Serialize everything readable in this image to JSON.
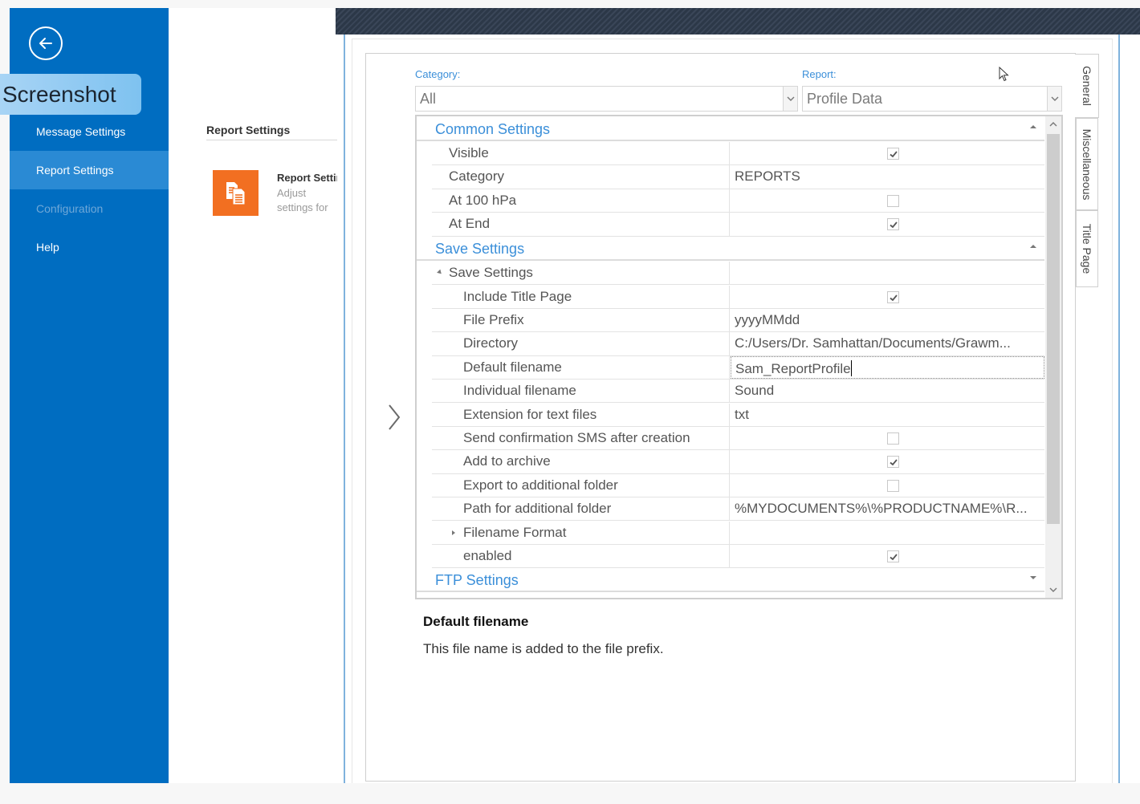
{
  "overlay_badge": "Screenshot",
  "sidebar": {
    "back_label": "Back",
    "items": [
      {
        "label": "Message Settings",
        "state": "normal"
      },
      {
        "label": "Report Settings",
        "state": "active"
      },
      {
        "label": "Configuration",
        "state": "disabled"
      },
      {
        "label": "Help",
        "state": "normal"
      }
    ]
  },
  "middle": {
    "section_title": "Report Settings",
    "tile": {
      "title": "Report Settings",
      "description": "Adjust settings for the design of the"
    }
  },
  "filters": {
    "category_label": "Category:",
    "category_value": "All",
    "report_label": "Report:",
    "report_value": "Profile Data"
  },
  "tabs": [
    {
      "label": "General",
      "active": true
    },
    {
      "label": "Miscellaneous",
      "active": false
    },
    {
      "label": "Title Page",
      "active": false
    }
  ],
  "grid": {
    "categories": [
      {
        "label": "Common Settings",
        "expanded": true
      },
      {
        "label": "Save Settings",
        "expanded": true
      },
      {
        "label": "FTP Settings",
        "expanded": false
      }
    ],
    "common_settings": [
      {
        "name": "Visible",
        "type": "checkbox",
        "checked": true
      },
      {
        "name": "Category",
        "type": "text",
        "value": "REPORTS"
      },
      {
        "name": "At 100 hPa",
        "type": "checkbox",
        "checked": false
      },
      {
        "name": "At End",
        "type": "checkbox",
        "checked": true
      }
    ],
    "save_settings_group": "Save Settings",
    "save_settings": [
      {
        "name": "Include Title Page",
        "type": "checkbox",
        "checked": true
      },
      {
        "name": "File Prefix",
        "type": "text",
        "value": "yyyyMMdd"
      },
      {
        "name": "Directory",
        "type": "text",
        "value": "C:/Users/Dr. Samhattan/Documents/Grawm..."
      },
      {
        "name": "Default filename",
        "type": "text",
        "value": "Sam_ReportProfile",
        "editing": true
      },
      {
        "name": "Individual filename",
        "type": "text",
        "value": "Sound"
      },
      {
        "name": "Extension for text files",
        "type": "text",
        "value": "txt"
      },
      {
        "name": "Send confirmation SMS after creation",
        "type": "checkbox",
        "checked": false
      },
      {
        "name": "Add to archive",
        "type": "checkbox",
        "checked": true
      },
      {
        "name": "Export to additional folder",
        "type": "checkbox",
        "checked": false
      },
      {
        "name": "Path for additional folder",
        "type": "text",
        "value": "%MYDOCUMENTS%\\%PRODUCTNAME%\\R..."
      },
      {
        "name": "Filename Format",
        "type": "group",
        "value": ""
      },
      {
        "name": "enabled",
        "type": "checkbox",
        "checked": true
      }
    ]
  },
  "description": {
    "title": "Default filename",
    "text": "This file name is added to the file prefix."
  },
  "colors": {
    "sidebar_blue": "#006dc1",
    "sidebar_active": "#2a8ad4",
    "accent_blue": "#3b8fd9",
    "tile_orange": "#f26f21"
  }
}
